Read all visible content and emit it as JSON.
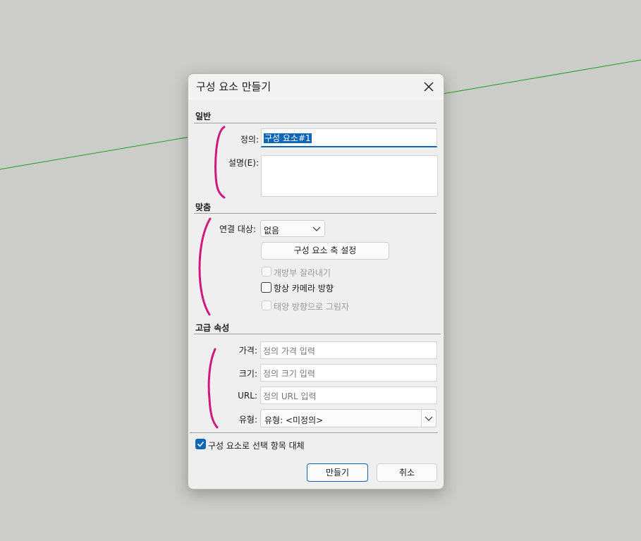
{
  "dialog": {
    "title": "구성 요소 만들기",
    "close_icon": "close-icon"
  },
  "general": {
    "section": "일반",
    "definition_label": "정의:",
    "definition_value": "구성 요소#1",
    "description_label": "설명(E):",
    "description_value": ""
  },
  "alignment": {
    "section": "맞춤",
    "glue_to_label": "연결 대상:",
    "glue_to_value": "없음",
    "set_axes_button": "구성 요소 축 설정",
    "cut_opening_label": "개방부 잘라내기",
    "cut_opening_checked": false,
    "always_face_camera_label": "항상 카메라 방향",
    "always_face_camera_checked": false,
    "shadows_face_sun_label": "태양 방향으로 그림자",
    "shadows_face_sun_checked": false
  },
  "advanced": {
    "section": "고급 속성",
    "price_label": "가격:",
    "price_placeholder": "정의 가격 입력",
    "size_label": "크기:",
    "size_placeholder": "정의 크기 입력",
    "url_label": "URL:",
    "url_placeholder": "정의 URL 입력",
    "type_label": "유형:",
    "type_value": "유형: <미정의>"
  },
  "replace_selection": {
    "label": "구성 요소로 선택 항목 대체",
    "checked": true
  },
  "buttons": {
    "create": "만들기",
    "cancel": "취소"
  },
  "colors": {
    "accent": "#0e66b8",
    "annotation_marker": "#d0197d",
    "background_axis_line": "#1fa01f"
  }
}
